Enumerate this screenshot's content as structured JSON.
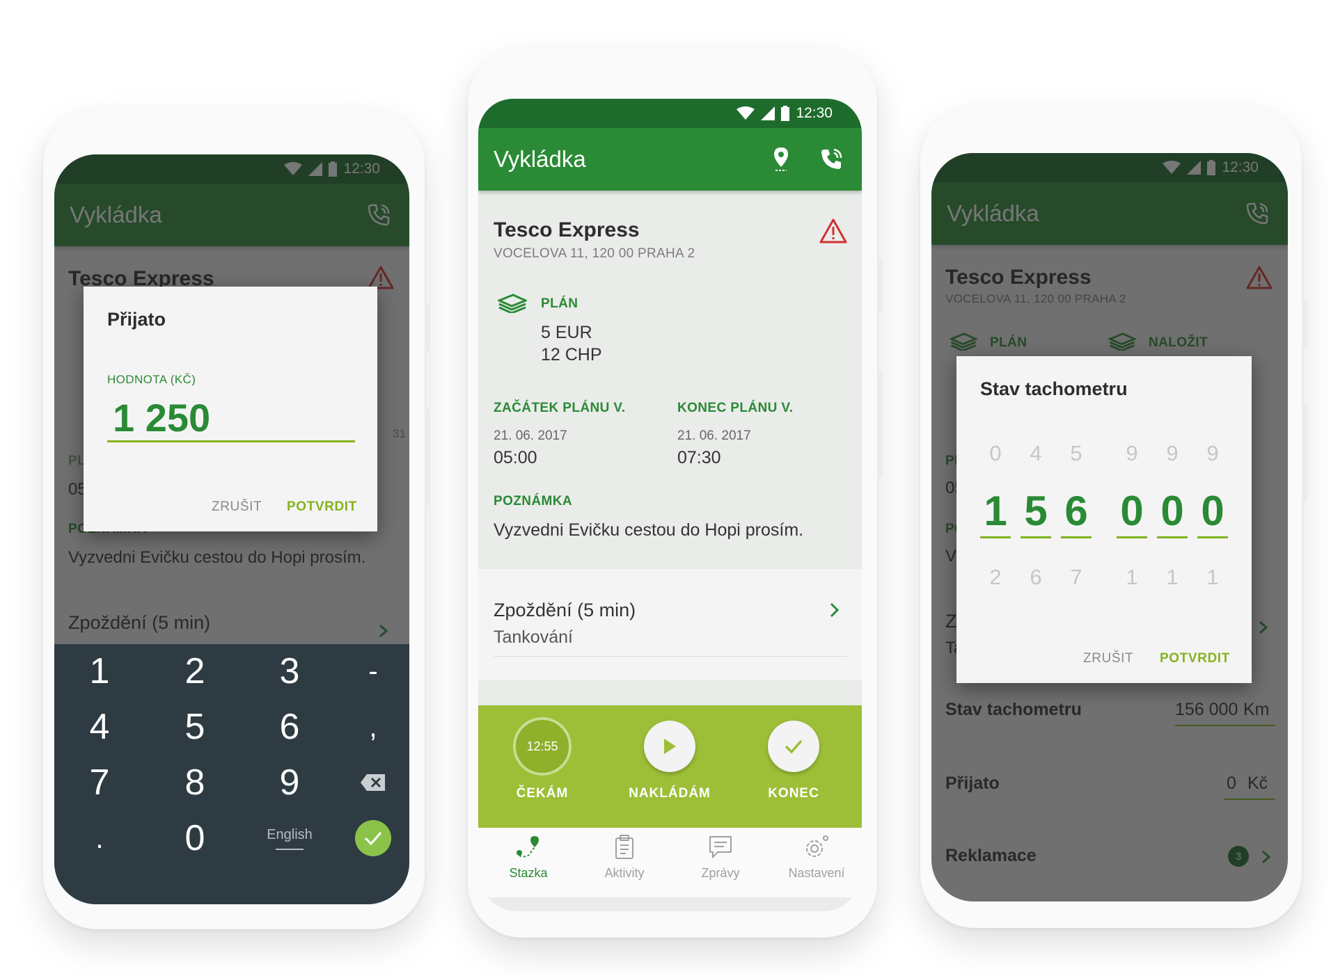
{
  "status": {
    "time": "12:30"
  },
  "app": {
    "title": "Vykládka"
  },
  "store": {
    "name": "Tesco Express",
    "address": "VOCELOVA 11, 120 00 PRAHA 2"
  },
  "plan": {
    "label": "PLÁN",
    "items": [
      "5 EUR",
      "12 CHP"
    ]
  },
  "nalozit": {
    "label": "NALOŽIT"
  },
  "schedule": {
    "start_label": "ZAČÁTEK PLÁNU V.",
    "start_date": "21. 06. 2017",
    "start_time": "05:00",
    "end_label": "KONEC PLÁNU V.",
    "end_date": "21. 06. 2017",
    "end_time": "07:30"
  },
  "note": {
    "label": "POZNÁMKA",
    "text": "Vyzvedni Evičku cestou do Hopi prosím."
  },
  "delay": {
    "title": "Zpoždění (5 min)",
    "subtitle": "Tankování"
  },
  "actions": {
    "wait_time": "12:55",
    "wait_label": "ČEKÁM",
    "load_label": "NAKLÁDÁM",
    "end_label": "KONEC"
  },
  "nav": {
    "stazka": "Stazka",
    "aktivity": "Aktivity",
    "zpravy": "Zprávy",
    "nastaveni": "Nastavení"
  },
  "left": {
    "partial_pl": "PL",
    "partial_05": "05",
    "partial_31": "31",
    "partial_note": "POZNÁMKA",
    "dialog": {
      "title": "Přijato",
      "field_label": "HODNOTA (KČ)",
      "value": "1 250",
      "cancel": "ZRUŠIT",
      "confirm": "POTVRDIT"
    },
    "keypad": {
      "k1": "1",
      "k2": "2",
      "k3": "3",
      "kdash": "-",
      "k4": "4",
      "k5": "5",
      "k6": "6",
      "kcomma": ",",
      "k7": "7",
      "k8": "8",
      "k9": "9",
      "kdot": ".",
      "k0": "0",
      "lang": "English"
    }
  },
  "right": {
    "partial_pl": "PL",
    "partial_05": "05",
    "partial_po": "PO",
    "partial_vy": "Vy",
    "partial_zp": "Zp",
    "partial_ta": "Ta",
    "dialog": {
      "title": "Stav tachometru",
      "columns": [
        {
          "top": "0",
          "sel": "1",
          "bot": "2"
        },
        {
          "top": "4",
          "sel": "5",
          "bot": "6"
        },
        {
          "top": "5",
          "sel": "6",
          "bot": "7"
        },
        {
          "top": "9",
          "sel": "0",
          "bot": "1"
        },
        {
          "top": "9",
          "sel": "0",
          "bot": "1"
        },
        {
          "top": "9",
          "sel": "0",
          "bot": "1"
        }
      ],
      "cancel": "ZRUŠIT",
      "confirm": "POTVRDIT"
    },
    "rows": {
      "odo_label": "Stav tachometru",
      "odo_value": "156 000",
      "odo_unit": "Km",
      "prijato_label": "Přijato",
      "prijato_value": "0",
      "prijato_unit": "Kč",
      "reklamace_label": "Reklamace",
      "reklamace_count": "3"
    }
  },
  "colors": {
    "primary": "#2a8a35",
    "primary_dark": "#1d6c2c",
    "accent": "#9cbf37",
    "warning": "#d32f2f"
  }
}
